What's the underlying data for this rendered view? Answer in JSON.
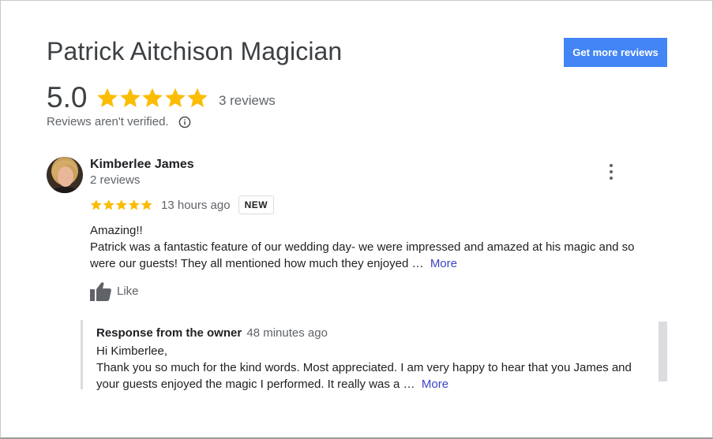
{
  "header": {
    "title": "Patrick Aitchison Magician",
    "get_more_label": "Get more reviews"
  },
  "summary": {
    "rating": "5.0",
    "stars": 5,
    "reviews_count": "3 reviews",
    "not_verified": "Reviews aren't verified."
  },
  "review": {
    "reviewer_name": "Kimberlee James",
    "reviewer_reviews": "2 reviews",
    "stars": 5,
    "time": "13 hours ago",
    "badge": "NEW",
    "line1": "Amazing!!",
    "line2": "Patrick was a fantastic feature of our wedding day- we were impressed and amazed at his magic and so",
    "line3": "were our guests! They all mentioned how much they enjoyed …",
    "more_label": "More",
    "like_label": "Like"
  },
  "response": {
    "owner_label": "Response from the owner",
    "time": "48 minutes ago",
    "line1": "Hi Kimberlee,",
    "line2": "Thank you so much for the kind words. Most appreciated. I am very happy to hear that you James and",
    "line3": "your guests enjoyed the magic I performed. It really was a …",
    "more_label": "More"
  },
  "colors": {
    "star": "#fbbc04",
    "button": "#4285f4",
    "link": "#3b44c4"
  },
  "icons": {
    "info": "info-icon",
    "more": "more-vert-icon",
    "like": "thumb-up-icon"
  }
}
